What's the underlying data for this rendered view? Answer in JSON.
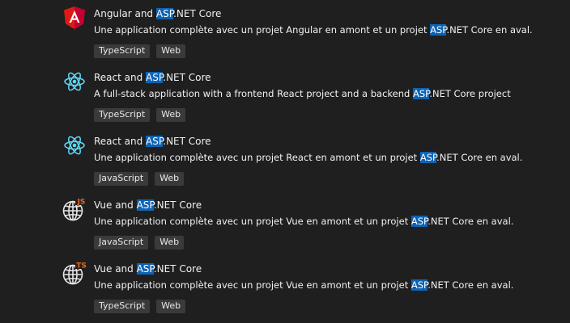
{
  "templates": [
    {
      "title_pre": "Angular and ",
      "title_hl": "ASP",
      "title_post": ".NET Core",
      "desc_pre": "Une application complète avec un projet Angular en amont et un projet ",
      "desc_hl": "ASP",
      "desc_post": ".NET Core en aval.",
      "tags": [
        "TypeScript",
        "Web"
      ],
      "icon": "angular-icon"
    },
    {
      "title_pre": "React and ",
      "title_hl": "ASP",
      "title_post": ".NET Core",
      "desc_pre": "A full-stack application with a frontend React project and a backend ",
      "desc_hl": "ASP",
      "desc_post": ".NET Core project",
      "tags": [
        "TypeScript",
        "Web"
      ],
      "icon": "react-icon"
    },
    {
      "title_pre": "React and ",
      "title_hl": "ASP",
      "title_post": ".NET Core",
      "desc_pre": "Une application complète avec un projet React en amont et un projet ",
      "desc_hl": "ASP",
      "desc_post": ".NET Core en aval.",
      "tags": [
        "JavaScript",
        "Web"
      ],
      "icon": "react-icon"
    },
    {
      "title_pre": "Vue and ",
      "title_hl": "ASP",
      "title_post": ".NET Core",
      "desc_pre": "Une application complète avec un projet Vue en amont et un projet ",
      "desc_hl": "ASP",
      "desc_post": ".NET Core en aval.",
      "tags": [
        "JavaScript",
        "Web"
      ],
      "icon": "globe-js-icon",
      "icon_badge": "JS"
    },
    {
      "title_pre": "Vue and ",
      "title_hl": "ASP",
      "title_post": ".NET Core",
      "desc_pre": "Une application complète avec un projet Vue en amont et un projet ",
      "desc_hl": "ASP",
      "desc_post": ".NET Core en aval.",
      "tags": [
        "TypeScript",
        "Web"
      ],
      "icon": "globe-ts-icon",
      "icon_badge": "TS"
    }
  ],
  "colors": {
    "background": "#1f1f1f",
    "highlight": "#0e63b4",
    "tag_background": "#3a3a3a",
    "angular_red": "#dd1b16",
    "react_blue": "#61dafb",
    "badge_orange": "#e86a1e"
  }
}
